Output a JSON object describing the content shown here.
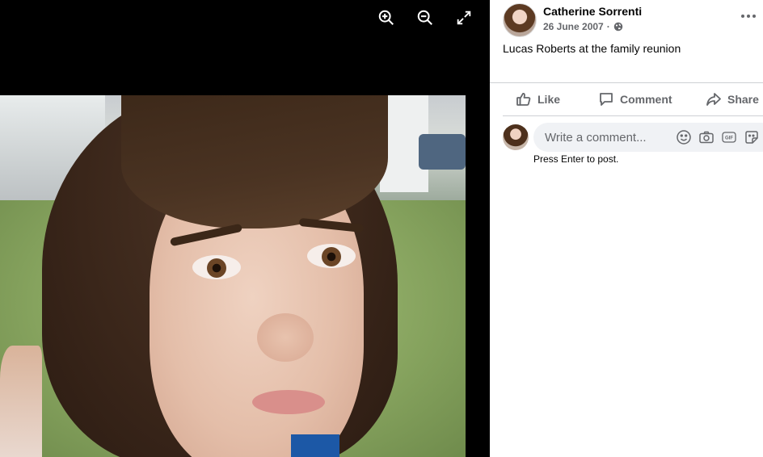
{
  "viewer": {
    "icons": [
      "zoom-in-icon",
      "zoom-out-icon",
      "fullscreen-icon"
    ]
  },
  "post": {
    "author": "Catherine Sorrenti",
    "date": "26 June 2007",
    "separator": "·",
    "privacy_icon": "globe-icon",
    "caption": "Lucas Roberts at the family reunion"
  },
  "actions": {
    "like": "Like",
    "comment": "Comment",
    "share": "Share"
  },
  "comment": {
    "placeholder": "Write a comment...",
    "hint": "Press Enter to post.",
    "icons": [
      "emoji-icon",
      "camera-icon",
      "gif-icon",
      "sticker-icon"
    ]
  },
  "colors": {
    "text_primary": "#050505",
    "text_secondary": "#65676b",
    "input_bg": "#f0f2f5",
    "divider": "#ced0d4",
    "viewer_bg": "#000000"
  }
}
